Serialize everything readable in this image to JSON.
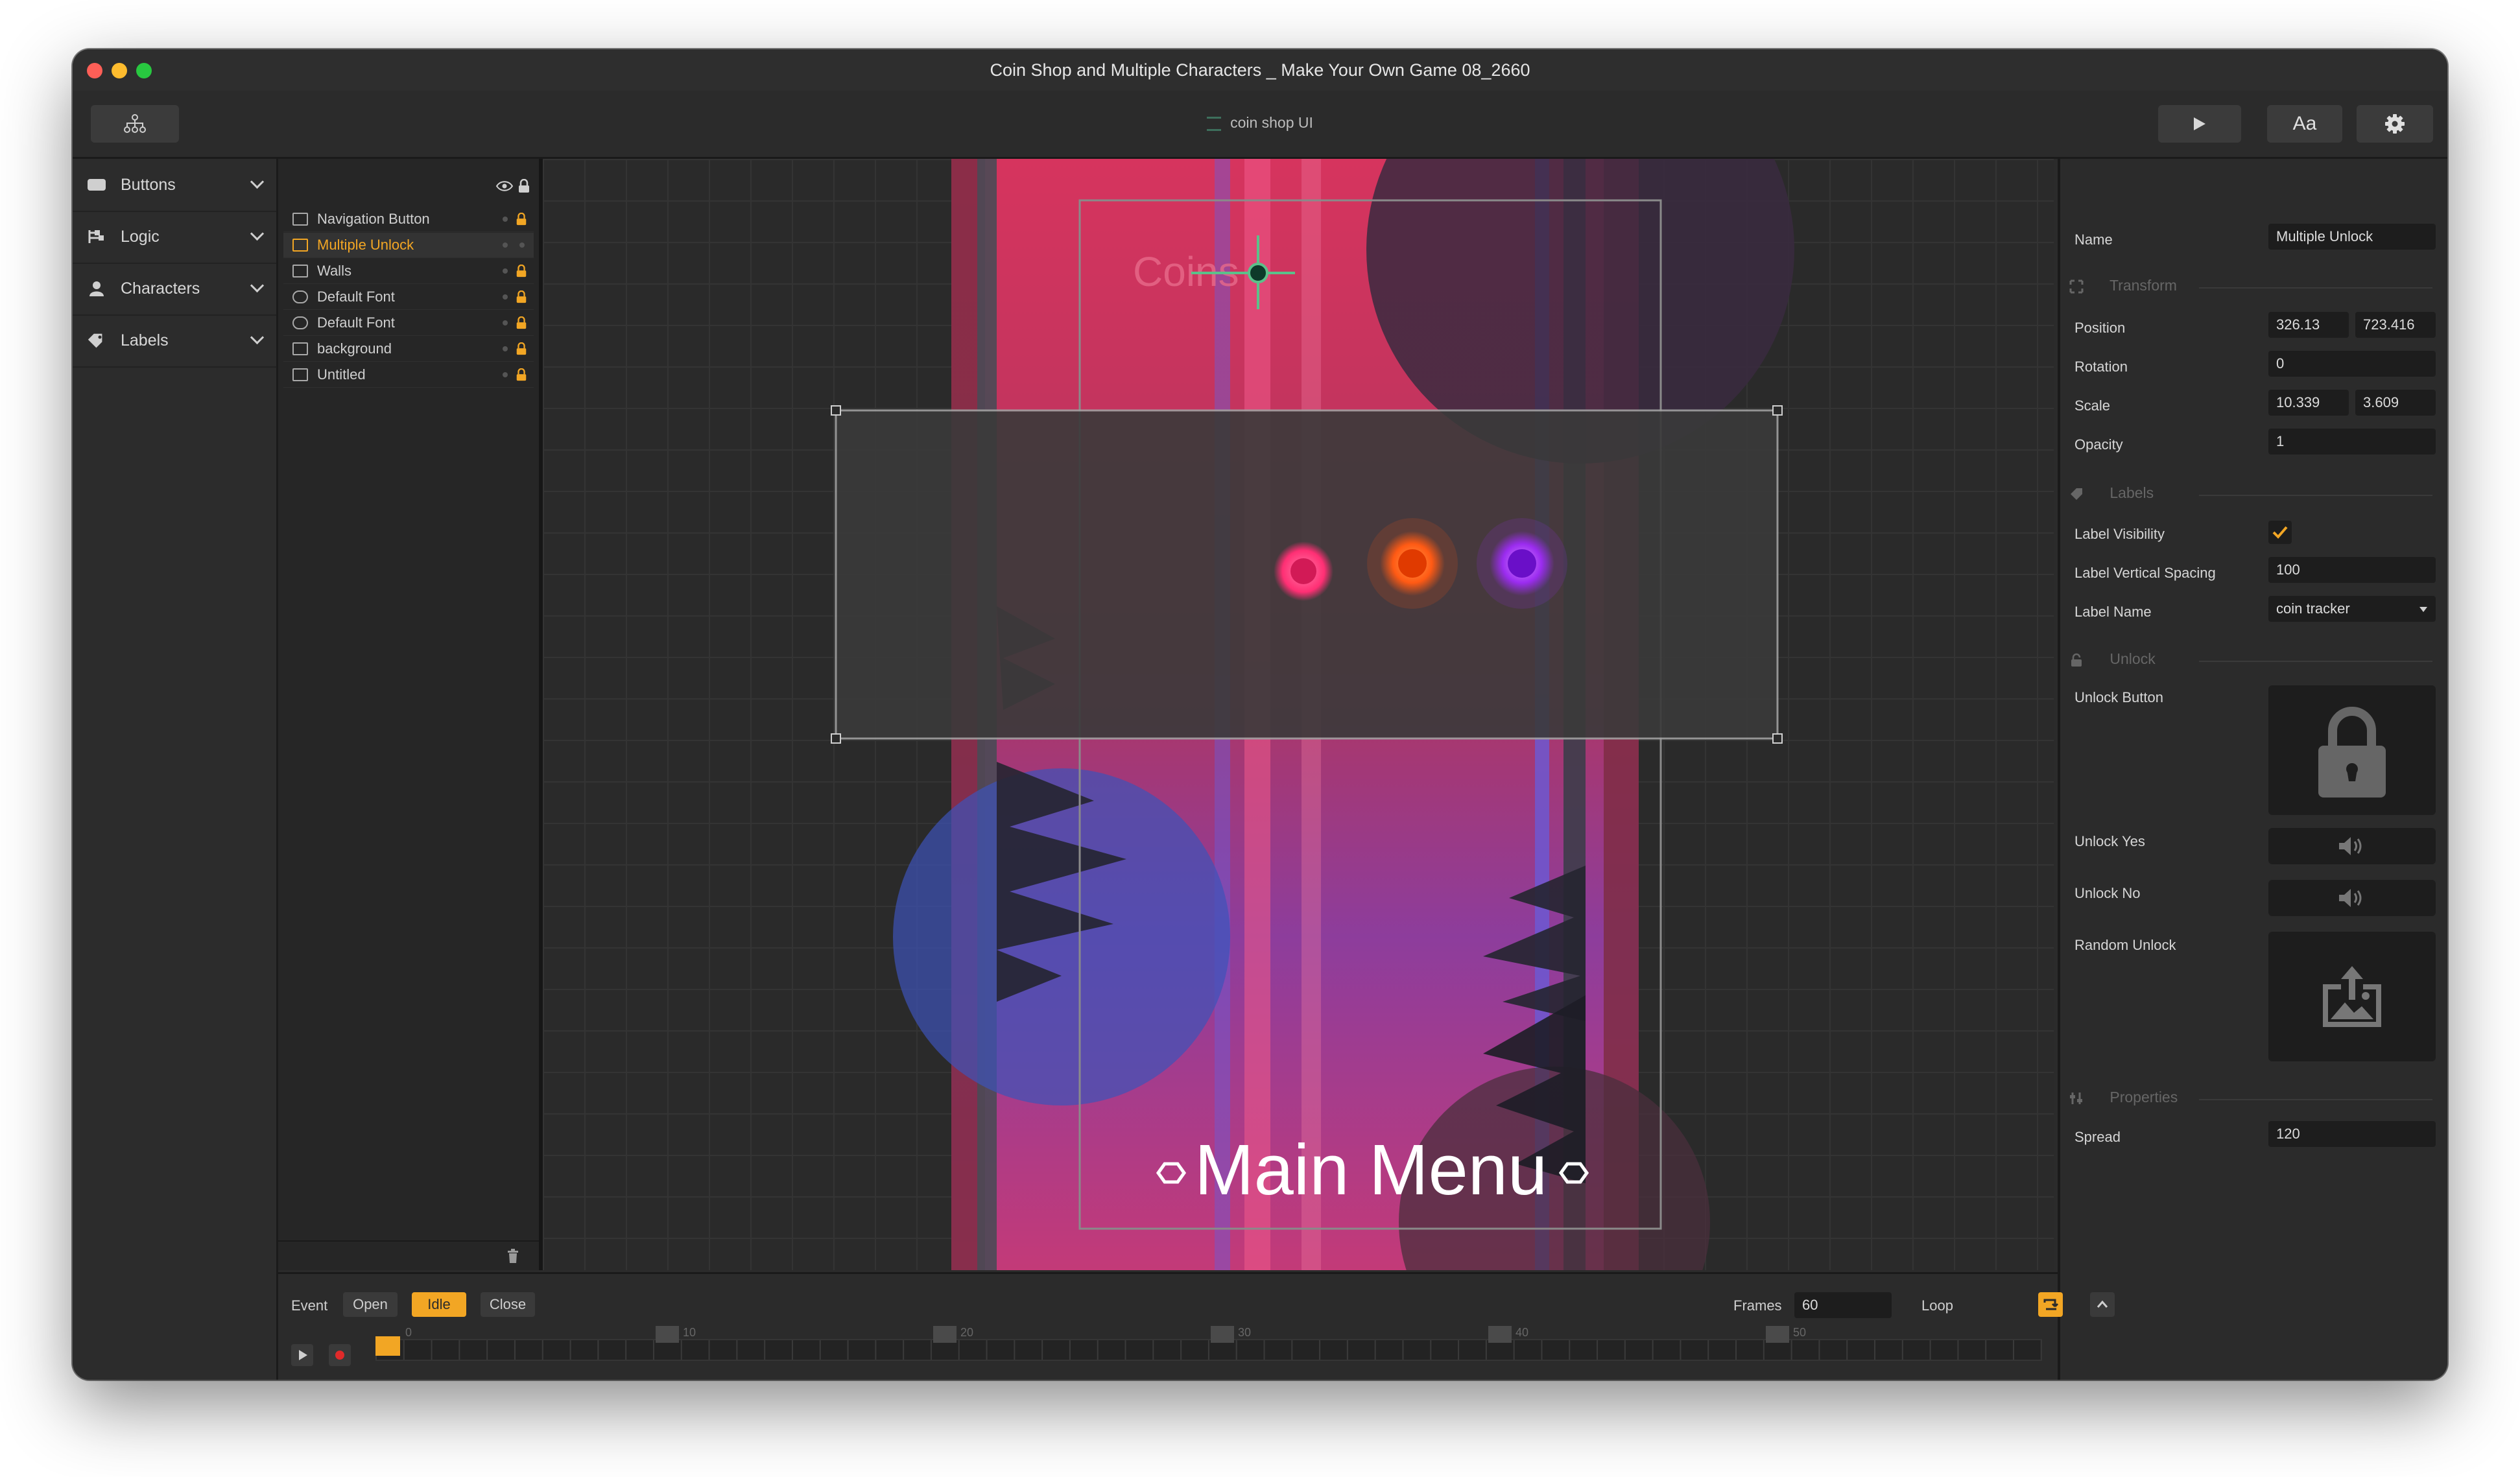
{
  "window": {
    "title": "Coin Shop and Multiple Characters _ Make Your Own Game 08_2660"
  },
  "toolbar": {
    "document_title": "coin shop UI",
    "font_button_label": "Aa"
  },
  "categories": [
    {
      "label": "Buttons"
    },
    {
      "label": "Logic"
    },
    {
      "label": "Characters"
    },
    {
      "label": "Labels"
    }
  ],
  "layers": [
    {
      "name": "Navigation Button"
    },
    {
      "name": "Multiple Unlock"
    },
    {
      "name": "Walls"
    },
    {
      "name": "Default Font"
    },
    {
      "name": "Default Font"
    },
    {
      "name": "background"
    },
    {
      "name": "Untitled"
    }
  ],
  "canvas": {
    "coins_label": "Coins",
    "main_menu_label": "Main Menu"
  },
  "inspector": {
    "name_label": "Name",
    "name_value": "Multiple Unlock",
    "transform_section": "Transform",
    "position_label": "Position",
    "position_x": "326.13",
    "position_y": "723.416",
    "rotation_label": "Rotation",
    "rotation_value": "0",
    "scale_label": "Scale",
    "scale_x": "10.339",
    "scale_y": "3.609",
    "opacity_label": "Opacity",
    "opacity_value": "1",
    "labels_section": "Labels",
    "label_visibility_label": "Label Visibility",
    "label_spacing_label": "Label Vertical Spacing",
    "label_spacing_value": "100",
    "label_name_label": "Label Name",
    "label_name_value": "coin tracker",
    "unlock_section": "Unlock",
    "unlock_button_label": "Unlock Button",
    "unlock_yes_label": "Unlock Yes",
    "unlock_no_label": "Unlock No",
    "random_unlock_label": "Random Unlock",
    "properties_section": "Properties",
    "spread_label": "Spread",
    "spread_value": "120"
  },
  "timeline": {
    "event_label": "Event",
    "open_label": "Open",
    "idle_label": "Idle",
    "close_label": "Close",
    "frames_label": "Frames",
    "frames_value": "60",
    "loop_label": "Loop",
    "ticks": [
      "0",
      "10",
      "20",
      "30",
      "40",
      "50"
    ]
  },
  "colors": {
    "accent": "#f2a624",
    "background": "#2b2b2b",
    "field": "#1d1d1d"
  }
}
